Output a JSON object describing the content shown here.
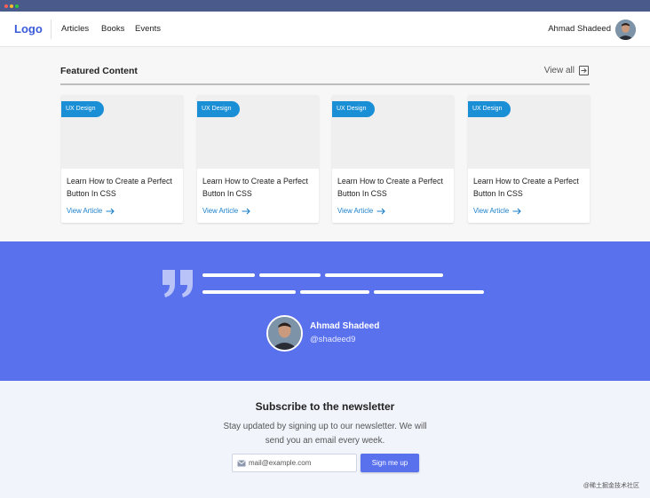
{
  "header": {
    "logo": "Logo",
    "nav": [
      "Articles",
      "Books",
      "Events"
    ],
    "user_name": "Ahmad Shadeed"
  },
  "featured": {
    "title": "Featured Content",
    "view_all": "View all",
    "cards": [
      {
        "tag": "UX Design",
        "title": "Learn How to Create a Perfect Button In CSS",
        "link": "View Article"
      },
      {
        "tag": "UX Design",
        "title": "Learn How to Create a Perfect Button In CSS",
        "link": "View Article"
      },
      {
        "tag": "UX Design",
        "title": "Learn How to Create a Perfect Button In CSS",
        "link": "View Article"
      },
      {
        "tag": "UX Design",
        "title": "Learn How to Create a Perfect Button In CSS",
        "link": "View Article"
      }
    ]
  },
  "testimonial": {
    "name": "Ahmad Shadeed",
    "handle": "@shadeed9"
  },
  "newsletter": {
    "title": "Subscribe to the newsletter",
    "description": "Stay updated by signing up to our newsletter. We will send you an email every week.",
    "email_placeholder": "mail@example.com",
    "button": "Sign me up"
  },
  "watermark": "@稀土掘金技术社区",
  "colors": {
    "accent": "#5a71ee",
    "brand": "#3a5bd9",
    "tag": "#1a8fd6",
    "link": "#1a7fc9"
  }
}
